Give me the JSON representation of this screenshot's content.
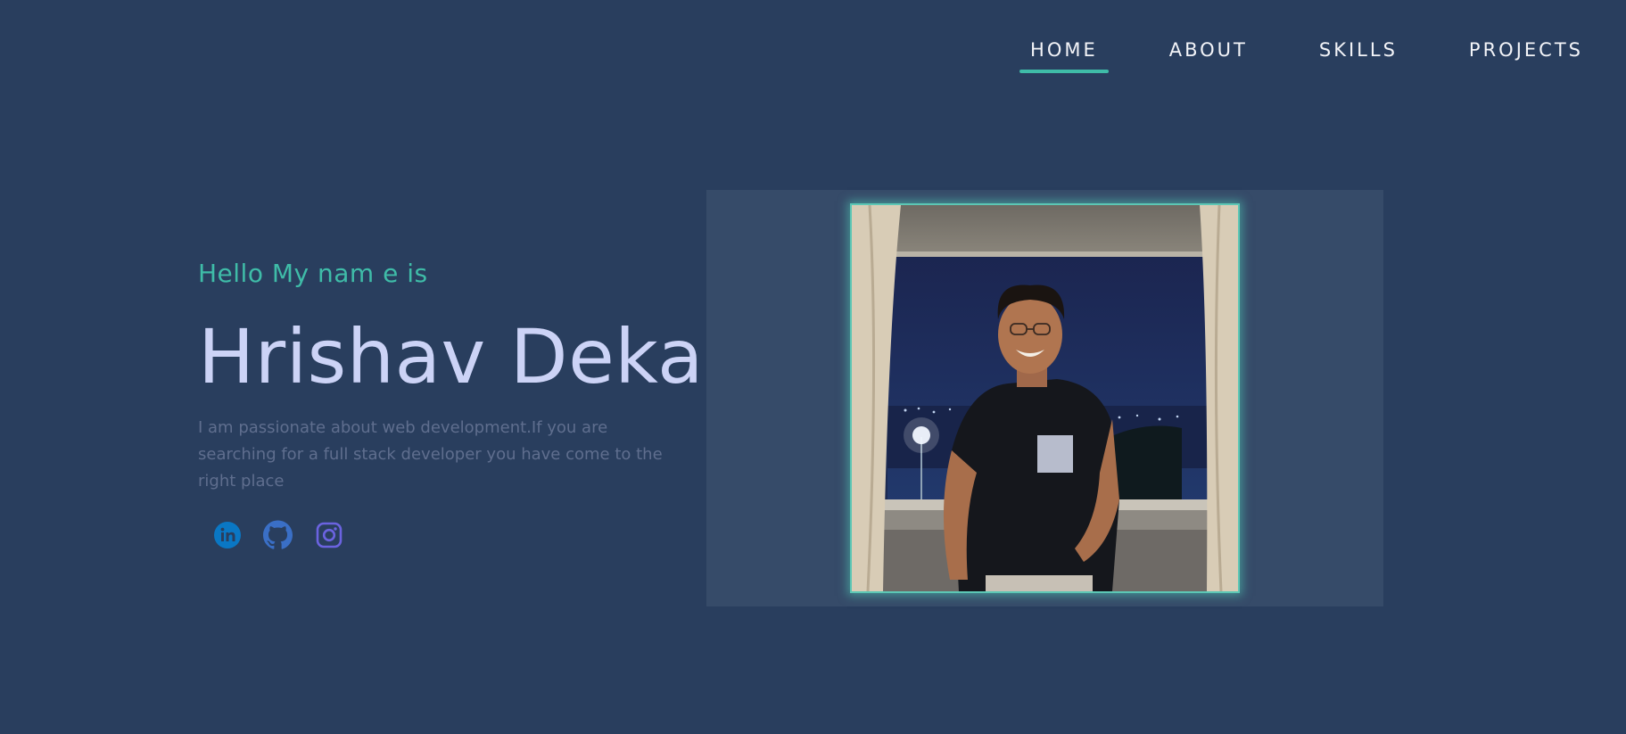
{
  "nav": {
    "items": [
      {
        "label": "HOME",
        "active": true
      },
      {
        "label": "ABOUT",
        "active": false
      },
      {
        "label": "SKILLS",
        "active": false
      },
      {
        "label": "PROJECTS",
        "active": false
      }
    ]
  },
  "intro": {
    "greeting": "Hello My nam e is",
    "name": "Hrishav Deka",
    "description": "I am passionate about web development.If you are searching for a full stack developer you have come to the right place"
  },
  "socials": [
    {
      "icon": "linkedin-icon",
      "color": "#0a77c4"
    },
    {
      "icon": "github-icon",
      "color": "#3a6fc6"
    },
    {
      "icon": "instagram-icon",
      "color": "#6b63e0"
    }
  ],
  "colors": {
    "background": "#293e5e",
    "accent": "#3fbca8",
    "name": "#ccd3f6",
    "description": "#5f6e8e",
    "photo_panel": "#364b69"
  }
}
